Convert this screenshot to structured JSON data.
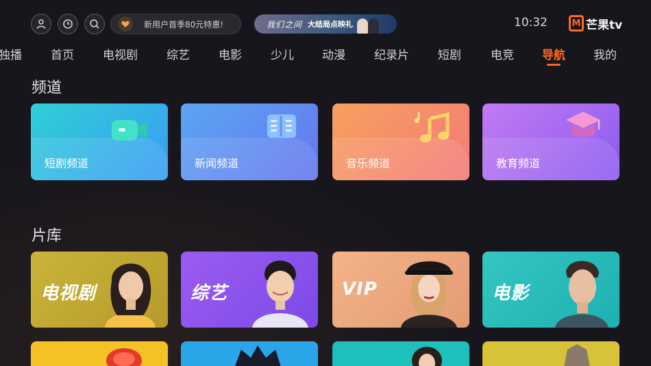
{
  "top_bar": {
    "icons": [
      "user-icon",
      "history-icon",
      "search-icon"
    ],
    "promo_text": "新用户首季80元特惠!",
    "banner_script": "我们之间",
    "banner_text": "大结局点映礼",
    "clock": "10:32",
    "logo_mark": "M",
    "logo_text": "芒果tv",
    "accent": "#ff6a1a"
  },
  "nav": {
    "items": [
      "独播",
      "首页",
      "电视剧",
      "综艺",
      "电影",
      "少儿",
      "动漫",
      "纪录片",
      "短剧",
      "电竞",
      "导航",
      "我的"
    ],
    "active": "导航"
  },
  "channels": {
    "title": "频道",
    "cards": [
      {
        "label": "短剧频道",
        "icon": "video-camera-icon"
      },
      {
        "label": "新闻频道",
        "icon": "newspaper-icon"
      },
      {
        "label": "音乐频道",
        "icon": "music-note-icon"
      },
      {
        "label": "教育频道",
        "icon": "graduation-cap-icon"
      }
    ]
  },
  "library": {
    "title": "片库",
    "cards": [
      {
        "label": "电视剧"
      },
      {
        "label": "综艺"
      },
      {
        "label": "VIP"
      },
      {
        "label": "电影"
      }
    ]
  }
}
